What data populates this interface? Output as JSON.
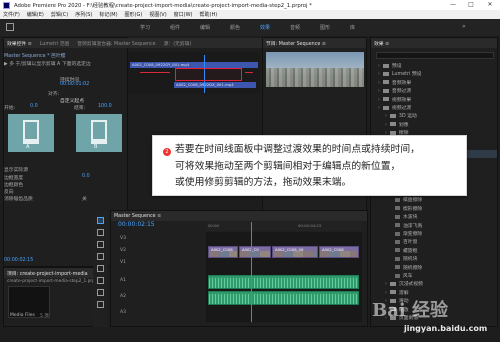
{
  "window": {
    "title": "Adobe Premiere Pro 2020 - F:\\经验教程\\create-project-import-media\\create-project-import-media-step2_1.prproj *",
    "controls": [
      "—",
      "□",
      "✕"
    ]
  },
  "menu": [
    "文件(F)",
    "编辑(E)",
    "剪辑(C)",
    "序列(S)",
    "标记(M)",
    "图形(G)",
    "视图(V)",
    "窗口(W)",
    "帮助(H)"
  ],
  "workspaces": {
    "items": [
      "学习",
      "组件",
      "编辑",
      "颜色",
      "效果",
      "音频",
      "图形",
      "库"
    ],
    "active": "效果",
    "more": "»"
  },
  "effect_controls": {
    "tabs": [
      "效果控件 ≡",
      "Lumetri 范围",
      "音频剪辑混合器: Master Sequence",
      "源：(无剪辑)"
    ],
    "source_line": "Master Sequence * 芭叶樱",
    "transition_line": "▶ 多 于/剪辑以显示剪辑 A 下面的选定边",
    "duration_label": "持续时间",
    "duration_value": "00:00:01:02",
    "align_label": "对齐:",
    "align_value": "自定义起点",
    "thumb_a": "A",
    "thumb_b": "B",
    "start_label": "开始:",
    "start_value": "0.0",
    "end_label": "结束:",
    "end_value": "100.0",
    "show_sources_label": "显示实际源",
    "border_width_label": "边框宽度",
    "border_width_value": "0.0",
    "border_color_label": "边框颜色",
    "reverse_label": "反向",
    "antialias_label": "消除锯齿品质",
    "antialias_value": "关",
    "timecode": "00:00:02:15"
  },
  "mini_timeline": {
    "clip_a": "A002_C008_0922GY_001.mp4",
    "clip_b": "A002_C008_0922DX_001.mp4"
  },
  "program_monitor": {
    "tab": "节目: Master Sequence ≡"
  },
  "effects": {
    "tab": "效果 ≡",
    "items": [
      {
        "label": "预设",
        "level": 0
      },
      {
        "label": "Lumetri 预设",
        "level": 0
      },
      {
        "label": "音频效果",
        "level": 0
      },
      {
        "label": "音频过渡",
        "level": 0
      },
      {
        "label": "视频效果",
        "level": 0
      },
      {
        "label": "视频过渡",
        "level": 0
      },
      {
        "label": "3D 运动",
        "level": 1
      },
      {
        "label": "划像",
        "level": 1
      },
      {
        "label": "擦除",
        "level": 1
      },
      {
        "label": "划出",
        "level": 2
      },
      {
        "label": "双侧平推门",
        "level": 2
      },
      {
        "label": "带状擦除",
        "level": 2
      },
      {
        "label": "径向擦除",
        "level": 2
      },
      {
        "label": "插入",
        "level": 2
      },
      {
        "label": "时钟式擦除",
        "level": 2
      },
      {
        "label": "棋盘",
        "level": 2
      },
      {
        "label": "棋盘擦除",
        "level": 2
      },
      {
        "label": "楔形擦除",
        "level": 2
      },
      {
        "label": "水波块",
        "level": 2
      },
      {
        "label": "油漆飞溅",
        "level": 2
      },
      {
        "label": "渐变擦除",
        "level": 2
      },
      {
        "label": "百叶窗",
        "level": 2
      },
      {
        "label": "螺旋框",
        "level": 2
      },
      {
        "label": "随机块",
        "level": 2
      },
      {
        "label": "随机擦除",
        "level": 2
      },
      {
        "label": "风车",
        "level": 2
      },
      {
        "label": "沉浸式视频",
        "level": 1
      },
      {
        "label": "溶解",
        "level": 1
      },
      {
        "label": "滑动",
        "level": 1
      },
      {
        "label": "缩放",
        "level": 1
      },
      {
        "label": "页面剥落",
        "level": 1
      }
    ]
  },
  "project": {
    "tabs": [
      "项目: create-project-import-media",
      "媒体浏览器"
    ],
    "path": "create-project-import-media-step2_1.prproj",
    "bin_label": "Media Files",
    "bin_count": "5 项"
  },
  "timeline": {
    "tab": "Master Sequence ≡",
    "timecode": "00:00:02:15",
    "ruler_start": "00:00",
    "ruler_mid": "00:00:04:23",
    "tracks": [
      "V3",
      "V2",
      "V1",
      "A1",
      "A2",
      "A3"
    ],
    "clips": [
      "A002_C008",
      "A002_C0",
      "A002_C008_09",
      "A002_C008"
    ]
  },
  "callout": {
    "number": "2",
    "lines": [
      "若要在时间线面板中调整过渡效果的时间点或持续时间，",
      "可将效果拖动至两个剪辑间相对于编辑点的新位置，",
      "或使用修剪剪辑的方法，拖动效果末端。"
    ]
  },
  "watermark": {
    "logo": "Bai 经验",
    "url": "jingyan.baidu.com"
  },
  "colors": {
    "accent": "#4aa3ff",
    "highlight_box": "#e8203b",
    "video_clip": "#7d6ea1",
    "audio_clip": "#2f9a6c"
  }
}
